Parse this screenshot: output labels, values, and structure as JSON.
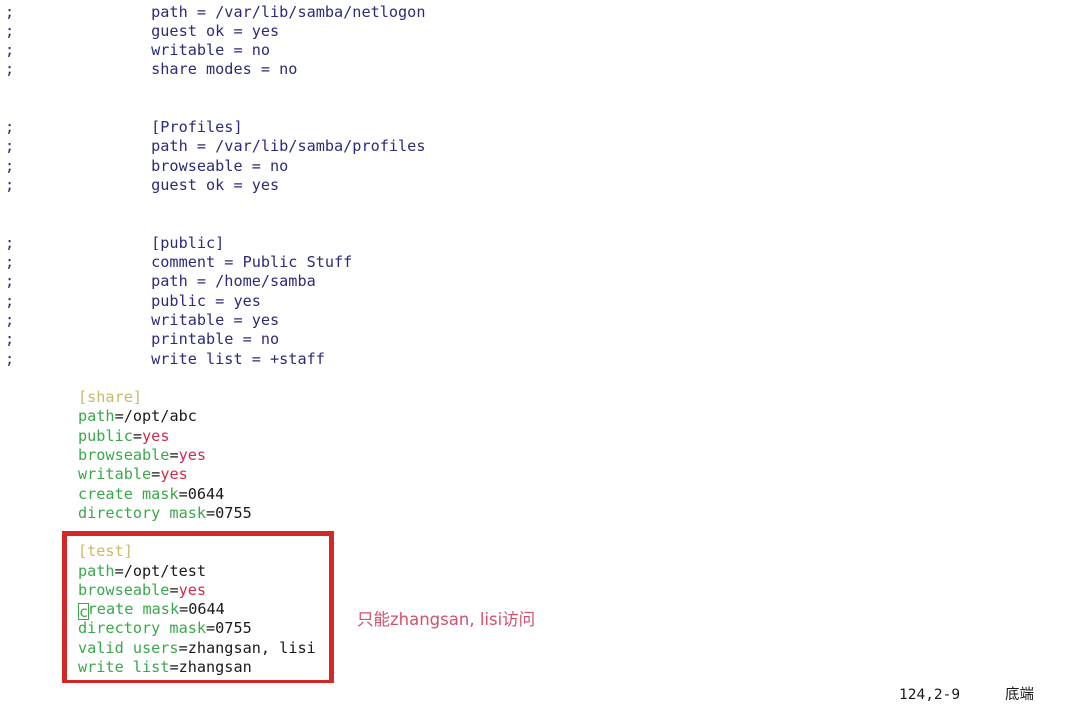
{
  "editor": {
    "kind": "vim-text-editor",
    "filetype": "samba-conf",
    "background_color": "#ffffff",
    "colors": {
      "comment": "#2b2b7a",
      "section_header": "#c8bc62",
      "key": "#3aa84a",
      "string_value": "#cf2b4a",
      "plain_value": "#1a1a1a",
      "annotation_box": "#d42828",
      "annotation_text": "#d4506a"
    },
    "lines": [
      {
        "mark": ";",
        "segments": [
          {
            "t": "        path = /var/lib/samba/netlogon",
            "c": "comment"
          }
        ]
      },
      {
        "mark": ";",
        "segments": [
          {
            "t": "        guest ok = yes",
            "c": "comment"
          }
        ]
      },
      {
        "mark": ";",
        "segments": [
          {
            "t": "        writable = no",
            "c": "comment"
          }
        ]
      },
      {
        "mark": ";",
        "segments": [
          {
            "t": "        share modes = no",
            "c": "comment"
          }
        ]
      },
      {
        "mark": "",
        "segments": []
      },
      {
        "mark": "",
        "segments": []
      },
      {
        "mark": ";",
        "segments": [
          {
            "t": "        [Profiles]",
            "c": "comment"
          }
        ]
      },
      {
        "mark": ";",
        "segments": [
          {
            "t": "        path = /var/lib/samba/profiles",
            "c": "comment"
          }
        ]
      },
      {
        "mark": ";",
        "segments": [
          {
            "t": "        browseable = no",
            "c": "comment"
          }
        ]
      },
      {
        "mark": ";",
        "segments": [
          {
            "t": "        guest ok = yes",
            "c": "comment"
          }
        ]
      },
      {
        "mark": "",
        "segments": []
      },
      {
        "mark": "",
        "segments": []
      },
      {
        "mark": ";",
        "segments": [
          {
            "t": "        [public]",
            "c": "comment"
          }
        ]
      },
      {
        "mark": ";",
        "segments": [
          {
            "t": "        comment = Public Stuff",
            "c": "comment"
          }
        ]
      },
      {
        "mark": ";",
        "segments": [
          {
            "t": "        path = /home/samba",
            "c": "comment"
          }
        ]
      },
      {
        "mark": ";",
        "segments": [
          {
            "t": "        public = yes",
            "c": "comment"
          }
        ]
      },
      {
        "mark": ";",
        "segments": [
          {
            "t": "        writable = yes",
            "c": "comment"
          }
        ]
      },
      {
        "mark": ";",
        "segments": [
          {
            "t": "        printable = no",
            "c": "comment"
          }
        ]
      },
      {
        "mark": ";",
        "segments": [
          {
            "t": "        write list = +staff",
            "c": "comment"
          }
        ]
      },
      {
        "mark": "",
        "segments": []
      },
      {
        "mark": "",
        "segments": [
          {
            "t": "[share]",
            "c": "header"
          }
        ]
      },
      {
        "mark": "",
        "segments": [
          {
            "t": "path",
            "c": "key"
          },
          {
            "t": "=/opt/abc",
            "c": "plain"
          }
        ]
      },
      {
        "mark": "",
        "segments": [
          {
            "t": "public",
            "c": "key"
          },
          {
            "t": "=",
            "c": "punct"
          },
          {
            "t": "yes",
            "c": "val"
          }
        ]
      },
      {
        "mark": "",
        "segments": [
          {
            "t": "browseable",
            "c": "key"
          },
          {
            "t": "=",
            "c": "punct"
          },
          {
            "t": "yes",
            "c": "val"
          }
        ]
      },
      {
        "mark": "",
        "segments": [
          {
            "t": "writable",
            "c": "key"
          },
          {
            "t": "=",
            "c": "punct"
          },
          {
            "t": "yes",
            "c": "val"
          }
        ]
      },
      {
        "mark": "",
        "segments": [
          {
            "t": "create mask",
            "c": "key"
          },
          {
            "t": "=0644",
            "c": "plain"
          }
        ]
      },
      {
        "mark": "",
        "segments": [
          {
            "t": "directory mask",
            "c": "key"
          },
          {
            "t": "=0755",
            "c": "plain"
          }
        ]
      },
      {
        "mark": "",
        "segments": []
      },
      {
        "mark": "",
        "segments": [
          {
            "t": "[test]",
            "c": "header"
          }
        ]
      },
      {
        "mark": "",
        "segments": [
          {
            "t": "path",
            "c": "key"
          },
          {
            "t": "=/opt/test",
            "c": "plain"
          }
        ]
      },
      {
        "mark": "",
        "segments": [
          {
            "t": "browseable",
            "c": "key"
          },
          {
            "t": "=",
            "c": "punct"
          },
          {
            "t": "yes",
            "c": "val"
          }
        ]
      },
      {
        "mark": "",
        "segments": [
          {
            "t": "c",
            "c": "key",
            "cursor": true
          },
          {
            "t": "reate mask",
            "c": "key"
          },
          {
            "t": "=0644",
            "c": "plain"
          }
        ]
      },
      {
        "mark": "",
        "segments": [
          {
            "t": "directory mask",
            "c": "key"
          },
          {
            "t": "=0755",
            "c": "plain"
          }
        ]
      },
      {
        "mark": "",
        "segments": [
          {
            "t": "valid users",
            "c": "key"
          },
          {
            "t": "=zhangsan, lisi",
            "c": "plain"
          }
        ]
      },
      {
        "mark": "",
        "segments": [
          {
            "t": "write list",
            "c": "key"
          },
          {
            "t": "=zhangsan",
            "c": "plain"
          }
        ]
      },
      {
        "mark": "~",
        "segments": []
      }
    ]
  },
  "annotation": {
    "note_text": "只能zhangsan, lisi访问",
    "box_label": "test-share-highlight"
  },
  "status": {
    "ruler": "124,2-9",
    "position_label": "底端"
  }
}
